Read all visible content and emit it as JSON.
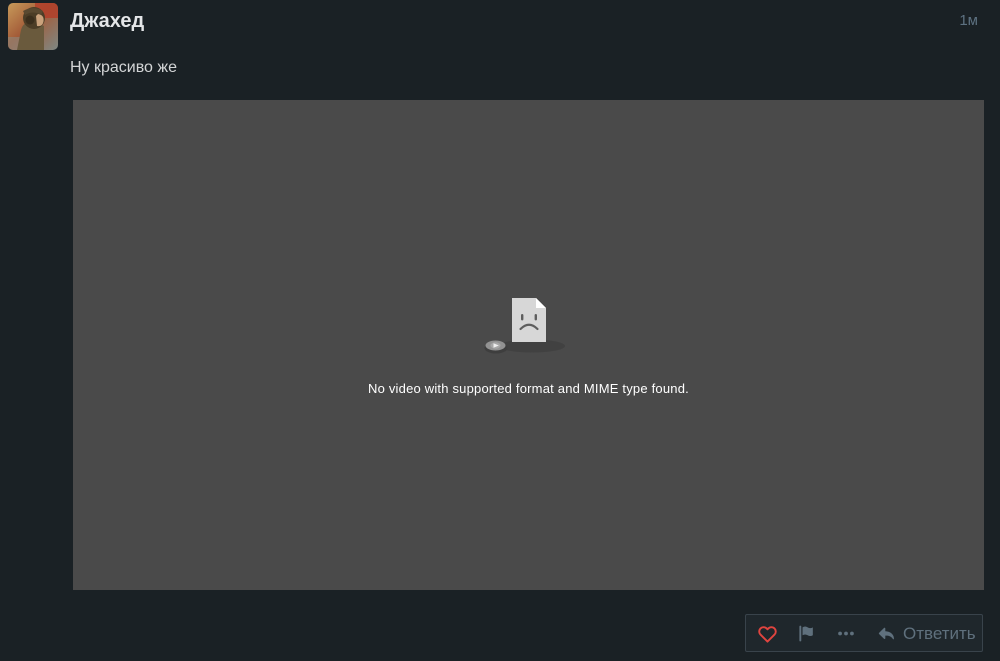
{
  "post": {
    "author": "Джахед",
    "timestamp": "1м",
    "body": "Ну красиво же"
  },
  "video_player": {
    "error_message": "No video with supported format and MIME type found."
  },
  "action_bar": {
    "reply_label": "Ответить"
  },
  "icons": {
    "like": "heart-outline-icon",
    "flag": "flag-icon",
    "more": "ellipsis-icon",
    "reply": "reply-arrow-icon",
    "broken_media": "sad-file-icon",
    "media_disc": "disc-play-icon"
  },
  "colors": {
    "page_bg": "#1a2125",
    "video_bg": "#4a4a4a",
    "like_red": "#e0443f",
    "icon_gray": "#5f707d",
    "author_text": "#e4e6e8",
    "body_text": "#d3d5d6",
    "timestamp_text": "#5d7181",
    "error_text": "#ffffff",
    "bar_bg": "#1f272c",
    "bar_border": "#39434b"
  }
}
